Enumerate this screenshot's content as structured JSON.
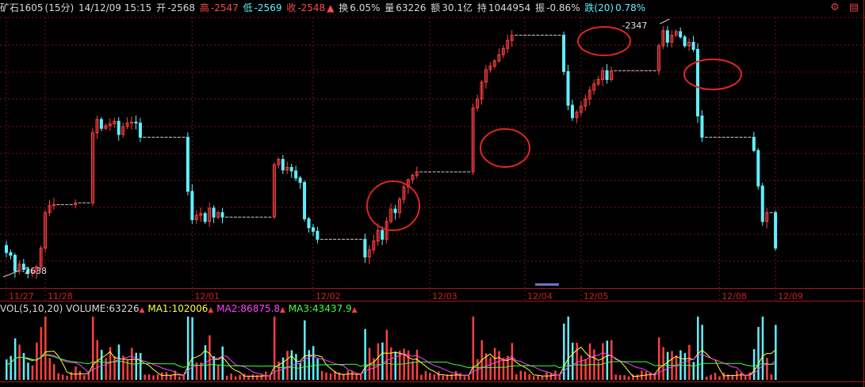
{
  "header": {
    "instrument": "矿石1605",
    "period": "(15分)",
    "datetime": "14/12/09 15:15",
    "open_label": "开",
    "open": "-2568",
    "high_label": "高",
    "high": "-2547",
    "low_label": "低",
    "low": "-2569",
    "close_label": "收",
    "close": "-2548",
    "turnover_label": "换",
    "turnover": "6.05%",
    "volume_label": "量",
    "volume": "63226",
    "amount_label": "额",
    "amount": "30.1亿",
    "oi_label": "持",
    "oi": "1044954",
    "amplitude_label": "振",
    "amplitude": "-0.86%",
    "change_label": "跌(20)",
    "change": "0.78%"
  },
  "toolbar": {
    "icons": [
      "gear-icon",
      "trade-icon"
    ]
  },
  "volume_header": {
    "title": "VOL(5,10,20)",
    "volume_label": "VOLUME:",
    "volume": "63226",
    "ma1_label": "MA1:",
    "ma1": "102006",
    "ma2_label": "MA2:",
    "ma2": "86875.8",
    "ma3_label": "MA3:",
    "ma3": "43437.9",
    "arrow": "▲"
  },
  "colors": {
    "up": "#ff4040",
    "down": "#5ff0ff",
    "ma1": "#ffff3c",
    "ma2": "#ff40ff",
    "ma3": "#3cff3c",
    "grid": "#7a1414",
    "circle": "#e02424"
  },
  "chart_data": {
    "type": "candlestick",
    "x_labels": [
      "11/27",
      "11/28",
      "12/01",
      "12/02",
      "12/03",
      "12/04",
      "12/05",
      "12/08",
      "12/09"
    ],
    "annotations": [
      {
        "text": "-2638",
        "kind": "period-low"
      },
      {
        "text": "-2347",
        "kind": "period-high"
      }
    ],
    "price_range": [
      -2645,
      -2340
    ],
    "closes": [
      -2605,
      -2608,
      -2626,
      -2618,
      -2624,
      -2628,
      -2627,
      -2621,
      -2600,
      -2560,
      -2552,
      -2551,
      -2551,
      -2551,
      -2551,
      -2551,
      -2549,
      -2549,
      -2549,
      -2549,
      -2470,
      -2455,
      -2465,
      -2462,
      -2460,
      -2457,
      -2472,
      -2463,
      -2459,
      -2458,
      -2459,
      -2475,
      -2475,
      -2475,
      -2475,
      -2475,
      -2475,
      -2475,
      -2475,
      -2475,
      -2475,
      -2475,
      -2536,
      -2568,
      -2563,
      -2561,
      -2570,
      -2555,
      -2565,
      -2560,
      -2565,
      -2565,
      -2565,
      -2565,
      -2565,
      -2565,
      -2565,
      -2565,
      -2565,
      -2565,
      -2565,
      -2565,
      -2506,
      -2500,
      -2512,
      -2509,
      -2513,
      -2521,
      -2526,
      -2567,
      -2577,
      -2581,
      -2590,
      -2590,
      -2590,
      -2590,
      -2590,
      -2590,
      -2590,
      -2590,
      -2590,
      -2590,
      -2590,
      -2610,
      -2602,
      -2592,
      -2580,
      -2590,
      -2570,
      -2556,
      -2560,
      -2545,
      -2531,
      -2523,
      -2518,
      -2514,
      -2514,
      -2514,
      -2514,
      -2514,
      -2514,
      -2514,
      -2514,
      -2514,
      -2514,
      -2514,
      -2514,
      -2514,
      -2442,
      -2432,
      -2413,
      -2399,
      -2395,
      -2389,
      -2382,
      -2375,
      -2366,
      -2360,
      -2360,
      -2360,
      -2360,
      -2360,
      -2360,
      -2360,
      -2360,
      -2360,
      -2360,
      -2360,
      -2360,
      -2401,
      -2439,
      -2453,
      -2447,
      -2440,
      -2432,
      -2422,
      -2415,
      -2410,
      -2400,
      -2410,
      -2400,
      -2400,
      -2400,
      -2400,
      -2400,
      -2400,
      -2400,
      -2400,
      -2400,
      -2400,
      -2400,
      -2372,
      -2355,
      -2368,
      -2360,
      -2356,
      -2362,
      -2372,
      -2368,
      -2376,
      -2451,
      -2475,
      -2475,
      -2475,
      -2475,
      -2475,
      -2475,
      -2475,
      -2475,
      -2475,
      -2475,
      -2475,
      -2475,
      -2490,
      -2530,
      -2570,
      -2560,
      -2560,
      -2600
    ],
    "volume": {
      "ma_periods": [
        5,
        10,
        20
      ],
      "last": 63226
    }
  }
}
